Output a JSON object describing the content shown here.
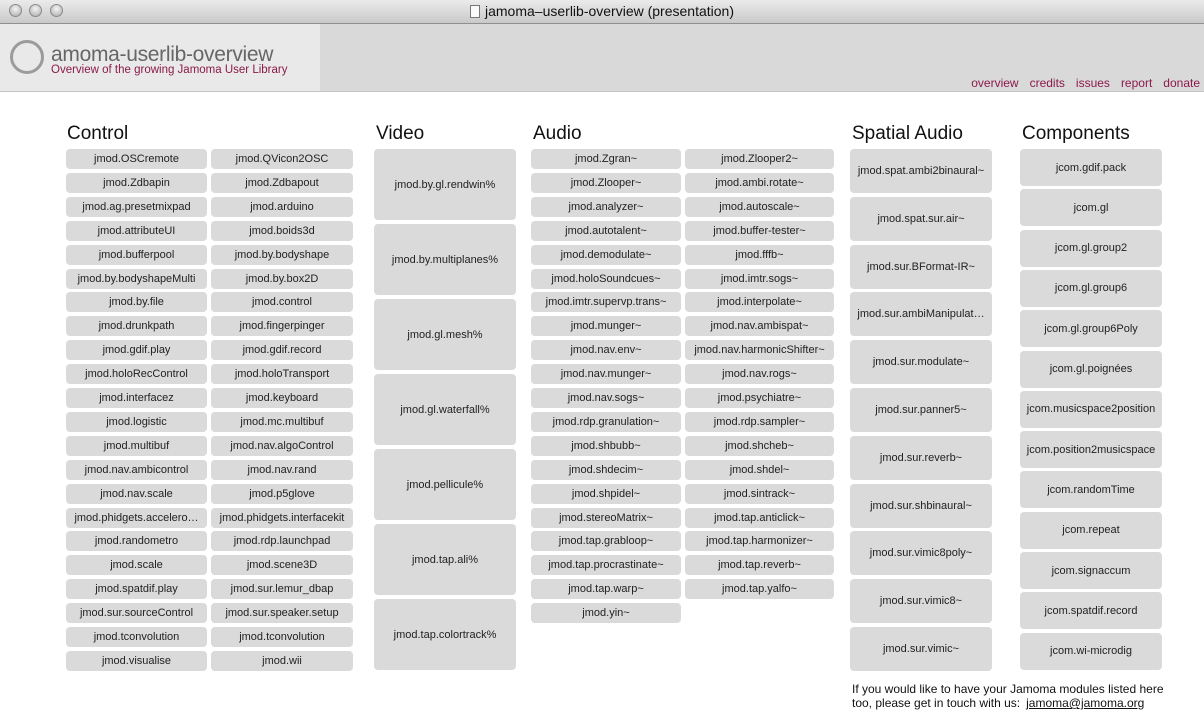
{
  "window": {
    "title": "jamoma–userlib-overview (presentation)"
  },
  "header": {
    "title": "amoma-userlib-overview",
    "subtitle": "Overview of the growing Jamoma User Library",
    "nav": [
      "overview",
      "credits",
      "issues",
      "report",
      "donate"
    ]
  },
  "columns": {
    "control": {
      "title": "Control",
      "items": [
        "jmod.OSCremote",
        "jmod.QVicon2OSC",
        "jmod.Zdbapin",
        "jmod.Zdbapout",
        "jmod.ag.presetmixpad",
        "jmod.arduino",
        "jmod.attributeUI",
        "jmod.boids3d",
        "jmod.bufferpool",
        "jmod.by.bodyshape",
        "jmod.by.bodyshapeMulti",
        "jmod.by.box2D",
        "jmod.by.file",
        "jmod.control",
        "jmod.drunkpath",
        "jmod.fingerpinger",
        "jmod.gdif.play",
        "jmod.gdif.record",
        "jmod.holoRecControl",
        "jmod.holoTransport",
        "jmod.interfacez",
        "jmod.keyboard",
        "jmod.logistic",
        "jmod.mc.multibuf",
        "jmod.multibuf",
        "jmod.nav.algoControl",
        "jmod.nav.ambicontrol",
        "jmod.nav.rand",
        "jmod.nav.scale",
        "jmod.p5glove",
        "jmod.phidgets.accelero…",
        "jmod.phidgets.interfacekit",
        "jmod.randometro",
        "jmod.rdp.launchpad",
        "jmod.scale",
        "jmod.scene3D",
        "jmod.spatdif.play",
        "jmod.sur.lemur_dbap",
        "jmod.sur.sourceControl",
        "jmod.sur.speaker.setup",
        "jmod.tconvolution",
        "jmod.tconvolution",
        "jmod.visualise",
        "jmod.wii"
      ]
    },
    "video": {
      "title": "Video",
      "items": [
        "jmod.by.gl.rendwin%",
        "jmod.by.multiplanes%",
        "jmod.gl.mesh%",
        "jmod.gl.waterfall%",
        "jmod.pellicule%",
        "jmod.tap.ali%",
        "jmod.tap.colortrack%"
      ]
    },
    "audio": {
      "title": "Audio",
      "left": [
        "jmod.Zgran~",
        "jmod.Zlooper~",
        "jmod.analyzer~",
        "jmod.autotalent~",
        "jmod.demodulate~",
        "jmod.holoSoundcues~",
        "jmod.imtr.supervp.trans~",
        "jmod.munger~",
        "jmod.nav.env~",
        "jmod.nav.munger~",
        "jmod.nav.sogs~",
        "jmod.rdp.granulation~",
        "jmod.shbubb~",
        "jmod.shdecim~",
        "jmod.shpidel~",
        "jmod.stereoMatrix~",
        "jmod.tap.grabloop~",
        "jmod.tap.procrastinate~",
        "jmod.tap.warp~",
        "jmod.yin~"
      ],
      "right": [
        "jmod.Zlooper2~",
        "jmod.ambi.rotate~",
        "jmod.autoscale~",
        "jmod.buffer-tester~",
        "jmod.fffb~",
        "jmod.imtr.sogs~",
        "jmod.interpolate~",
        "jmod.nav.ambispat~",
        "jmod.nav.harmonicShifter~",
        "jmod.nav.rogs~",
        "jmod.psychiatre~",
        "jmod.rdp.sampler~",
        "jmod.shcheb~",
        "jmod.shdel~",
        "jmod.sintrack~",
        "jmod.tap.anticlick~",
        "jmod.tap.harmonizer~",
        "jmod.tap.reverb~",
        "jmod.tap.yalfo~"
      ]
    },
    "spatial": {
      "title": "Spatial Audio",
      "items": [
        "jmod.spat.ambi2binaural~",
        "jmod.spat.sur.air~",
        "jmod.sur.BFormat-IR~",
        "jmod.sur.ambiManipulat…",
        "jmod.sur.modulate~",
        "jmod.sur.panner5~",
        "jmod.sur.reverb~",
        "jmod.sur.shbinaural~",
        "jmod.sur.vimic8poly~",
        "jmod.sur.vimic8~",
        "jmod.sur.vimic~"
      ]
    },
    "components": {
      "title": "Components",
      "items": [
        "jcom.gdif.pack",
        "jcom.gl",
        "jcom.gl.group2",
        "jcom.gl.group6",
        "jcom.gl.group6Poly",
        "jcom.gl.poignées",
        "jcom.musicspace2position",
        "jcom.position2musicspace",
        "jcom.randomTime",
        "jcom.repeat",
        "jcom.signaccum",
        "jcom.spatdif.record",
        "jcom.wi-microdig"
      ]
    }
  },
  "footer": {
    "note": "If you would like to have your Jamoma modules listed here too, please get in touch with us:",
    "email": "jamoma@jamoma.org"
  }
}
